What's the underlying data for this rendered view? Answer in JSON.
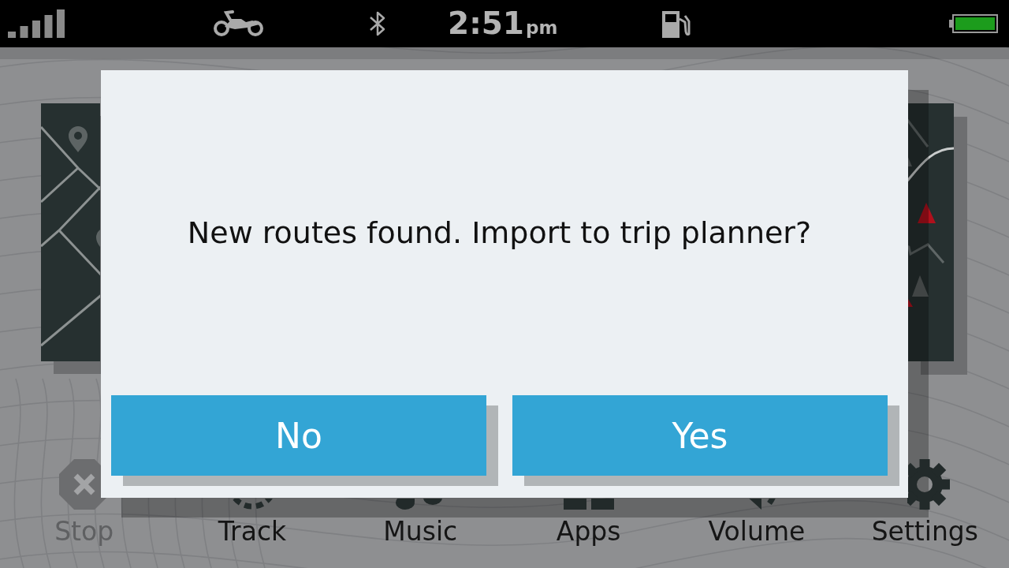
{
  "status_bar": {
    "time": "2:51",
    "time_period": "pm"
  },
  "dialog": {
    "message": "New routes found. Import to trip planner?",
    "buttons": [
      {
        "label": "No"
      },
      {
        "label": "Yes"
      }
    ]
  },
  "dock": [
    {
      "label": "Stop",
      "disabled": true
    },
    {
      "label": "Track",
      "disabled": false
    },
    {
      "label": "Music",
      "disabled": false
    },
    {
      "label": "Apps",
      "disabled": false
    },
    {
      "label": "Volume",
      "disabled": false
    },
    {
      "label": "Settings",
      "disabled": false
    }
  ]
}
